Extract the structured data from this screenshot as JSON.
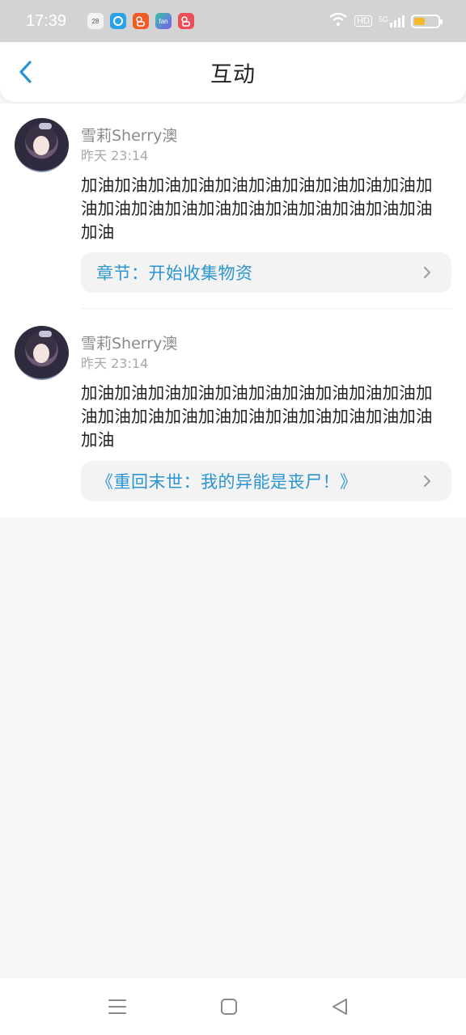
{
  "status_bar": {
    "time": "17:39",
    "notif_icons": [
      {
        "name": "calendar-icon",
        "label": "28",
        "color": "#f2f2f2",
        "text_color": "#555555"
      },
      {
        "name": "browser-icon",
        "label": "",
        "color": "#2aa3e6",
        "text_color": "#ffffff"
      },
      {
        "name": "kuaishou-icon",
        "label": "",
        "color": "#f25a24",
        "text_color": "#ffffff"
      },
      {
        "name": "app-fan-icon",
        "label": "fan",
        "color": "#36c2a8",
        "text_color": "#ffffff"
      },
      {
        "name": "kuaishou-icon-2",
        "label": "",
        "color": "#ee4d57",
        "text_color": "#ffffff"
      }
    ],
    "hd_label": "HD",
    "network_label": "5G",
    "battery_percent": 0.45,
    "battery_color": "#f5b92b"
  },
  "header": {
    "title": "互动",
    "back_icon": "chevron-left-icon",
    "accent_color": "#2b95d2"
  },
  "comments": [
    {
      "username": "雪莉Sherry澳",
      "time": "昨天 23:14",
      "text": "加油加油加油加油加油加油加油加油加油加油加油加油加油加油加油加油加油加油加油加油加油加油",
      "ref": "章节：开始收集物资"
    },
    {
      "username": "雪莉Sherry澳",
      "time": "昨天 23:14",
      "text": "加油加油加油加油加油加油加油加油加油加油加油加油加油加油加油加油加油加油加油加油加油加油",
      "ref": "《重回末世：我的异能是丧尸！》"
    }
  ],
  "nav_bar": {
    "menu_icon": "menu-icon",
    "home_icon": "home-square-icon",
    "back_icon": "back-triangle-icon"
  }
}
